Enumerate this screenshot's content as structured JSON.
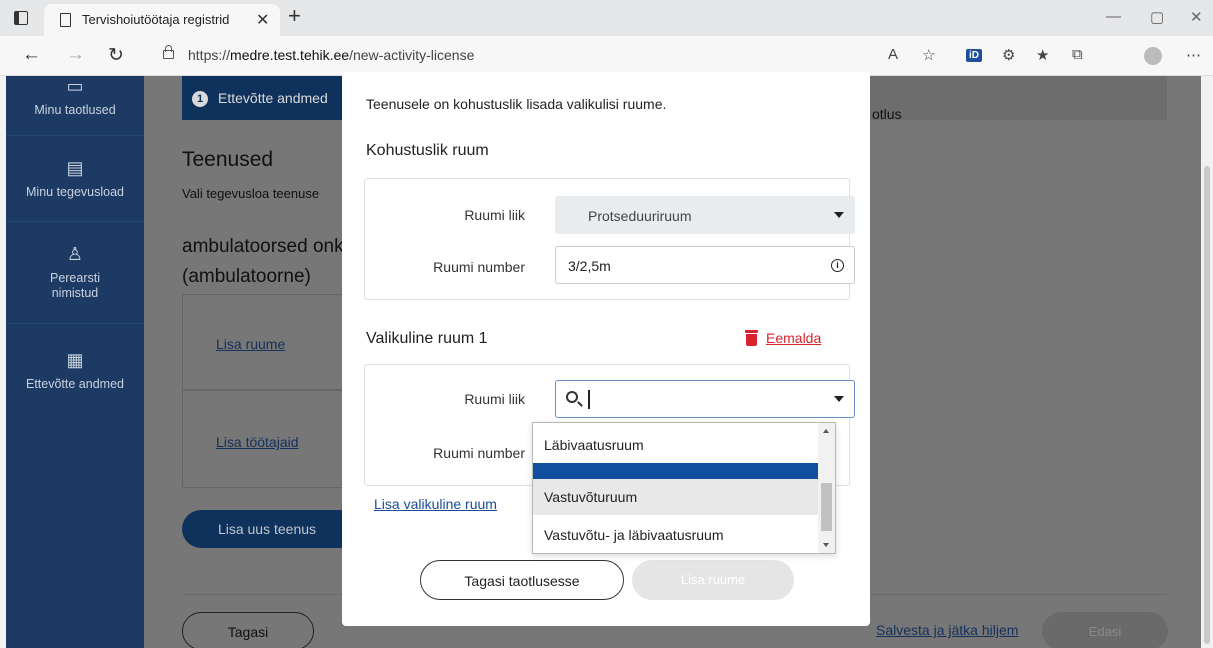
{
  "browser": {
    "tab_title": "Tervishoiutöötaja registrid",
    "url_prefix": "https://",
    "url_host": "medre.test.tehik.ee",
    "url_path": "/new-activity-license"
  },
  "sidebar": {
    "items": [
      {
        "label": "Minu taotlused",
        "icon": "file-icon"
      },
      {
        "label": "Minu tegevusload",
        "icon": "document-check-icon"
      },
      {
        "label": "Perearsti nimistud",
        "icon": "doctor-icon"
      },
      {
        "label": "Ettevõtte andmed",
        "icon": "building-icon"
      }
    ]
  },
  "background": {
    "step_number": "1",
    "step_label": "Ettevõtte andmed",
    "step_tail": "otlus",
    "title": "Teenused",
    "subtitle": "Vali tegevusloa teenuse",
    "service_title": "ambulatoorsed onk (ambulatoorne)",
    "link_rooms": "Lisa ruume",
    "link_employees": "Lisa töötajaid",
    "add_service": "Lisa uus teenus",
    "back": "Tagasi",
    "save_later": "Salvesta ja jätka hiljem",
    "next": "Edasi"
  },
  "modal": {
    "intro": "Teenusele on kohustuslik lisada valikulisi ruume.",
    "mandatory_title": "Kohustuslik ruum",
    "room_type_label": "Ruumi liik",
    "room_type_value": "Protseduuriruum",
    "room_number_label": "Ruumi number",
    "room_number_value": "3/2,5m",
    "optional_title": "Valikuline ruum 1",
    "remove": "Eemalda",
    "optional_room_type_label": "Ruumi liik",
    "optional_room_number_label": "Ruumi number",
    "add_optional": "Lisa valikuline ruum",
    "back_button": "Tagasi taotlusesse",
    "add_button": "Lisa ruume"
  },
  "dropdown": {
    "options": [
      "Läbivaatusruum",
      "Vastuvõturuum",
      "Vastuvõtu- ja läbivaatusruum"
    ]
  }
}
